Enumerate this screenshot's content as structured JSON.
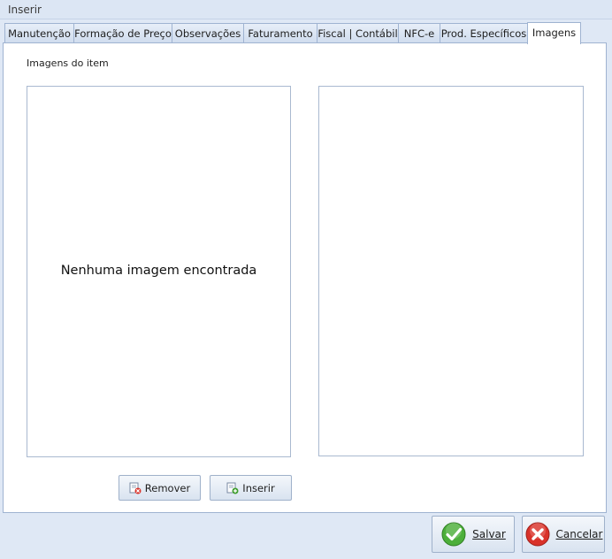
{
  "window": {
    "title": "Inserir"
  },
  "tabs": [
    {
      "label": "Manutenção",
      "active": false
    },
    {
      "label": "Formação de Preço",
      "active": false
    },
    {
      "label": "Observações",
      "active": false
    },
    {
      "label": "Faturamento",
      "active": false
    },
    {
      "label": "Fiscal | Contábil",
      "active": false
    },
    {
      "label": "NFC-e",
      "active": false
    },
    {
      "label": "Prod. Específicos",
      "active": false
    },
    {
      "label": "Imagens",
      "active": true
    }
  ],
  "images": {
    "group_label": "Imagens do item",
    "empty_message": "Nenhuma imagem encontrada",
    "remove_label": "Remover",
    "insert_label": "Inserir"
  },
  "footer": {
    "save_label": "Salvar",
    "cancel_label": "Cancelar"
  },
  "colors": {
    "background": "#dfe8f5",
    "tab_border": "#9fb3d1",
    "save_icon": "#4caf3a",
    "cancel_icon": "#d9322a"
  },
  "icons": {
    "remove": "remove-image-icon",
    "insert": "add-image-icon",
    "save": "check-icon",
    "cancel": "cancel-icon"
  }
}
